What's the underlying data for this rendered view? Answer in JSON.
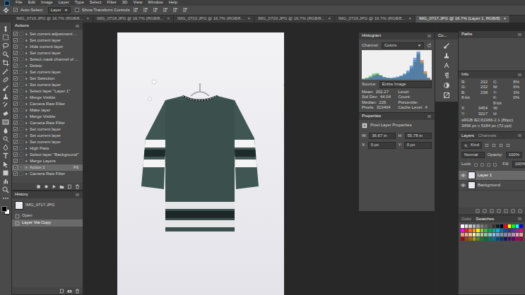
{
  "menu": [
    "File",
    "Edit",
    "Image",
    "Layer",
    "Type",
    "Select",
    "Filter",
    "3D",
    "View",
    "Window",
    "Help"
  ],
  "options_bar": {
    "auto_select_label": "Auto-Select:",
    "auto_select": true,
    "target": "Layer",
    "transform_label": "Show Transform Controls",
    "transform": false
  },
  "tab_close": "×",
  "document_tabs": [
    {
      "label": "IMG_0716.JPG @ 16.7% (RGB/8...",
      "selected": false
    },
    {
      "label": "IMG_0718.JPG @ 16.7% (RGB/8...",
      "selected": false
    },
    {
      "label": "IMG_0722.JPG @ 16.7% (RGB/8...",
      "selected": false
    },
    {
      "label": "IMG_0720.JPG @ 16.7% (RGB/8...",
      "selected": false
    },
    {
      "label": "IMG_0719.JPG @ 16.7% (RGB/8...",
      "selected": false
    },
    {
      "label": "IMG_0717.JPG @ 16.7% (Layer 1, RGB/8)",
      "selected": true
    }
  ],
  "actions": {
    "title": "Actions",
    "items": [
      {
        "label": "Set current adjustment ...",
        "checked": true,
        "selected": false
      },
      {
        "label": "Set current layer",
        "checked": true,
        "selected": false
      },
      {
        "label": "Hide current layer",
        "checked": true,
        "selected": false
      },
      {
        "label": "Set current layer",
        "checked": true,
        "selected": false
      },
      {
        "label": "Select mask channel of ...",
        "checked": true,
        "selected": false
      },
      {
        "label": "Delete",
        "checked": true,
        "selected": false
      },
      {
        "label": "Set current layer",
        "checked": true,
        "selected": false
      },
      {
        "label": "Set Selection",
        "checked": true,
        "selected": false
      },
      {
        "label": "Set current layer",
        "checked": true,
        "selected": false
      },
      {
        "label": "Select layer \"Layer 1\"",
        "checked": true,
        "selected": false
      },
      {
        "label": "Merge Visible",
        "checked": true,
        "selected": false
      },
      {
        "label": "Camera Raw Filter",
        "checked": true,
        "selected": false
      },
      {
        "label": "Make layer",
        "checked": true,
        "selected": false
      },
      {
        "label": "Merge Visible",
        "checked": true,
        "selected": false
      },
      {
        "label": "Camera Raw Filter",
        "checked": true,
        "selected": false
      },
      {
        "label": "Set current layer",
        "checked": true,
        "selected": false
      },
      {
        "label": "Set current layer",
        "checked": true,
        "selected": false
      },
      {
        "label": "Set current layer",
        "checked": true,
        "selected": false
      },
      {
        "label": "High Pass",
        "checked": true,
        "selected": false
      },
      {
        "label": "Select layer \"Background\"",
        "checked": true,
        "selected": false
      },
      {
        "label": "Merge Layers",
        "checked": true,
        "selected": false
      },
      {
        "label": "Action 1",
        "key": "F6",
        "checked": true,
        "selected": true
      },
      {
        "label": "Camera Raw Filter",
        "checked": true,
        "selected": false
      }
    ]
  },
  "history": {
    "title": "History",
    "snapshot": "IMG_0717.JPG",
    "items": [
      {
        "label": "Open",
        "selected": false
      },
      {
        "label": "Layer Via Copy",
        "selected": true
      }
    ]
  },
  "histogram": {
    "title": "Histogram",
    "channel_label": "Channel:",
    "channel": "Colors",
    "source_label": "Source:",
    "source": "Entire Image",
    "series": [
      {
        "name": "red",
        "color": "#e8322c",
        "values": [
          3,
          5,
          9,
          16,
          20,
          15,
          9,
          6,
          5,
          6,
          8,
          11,
          16,
          24,
          38,
          62,
          88,
          70,
          30,
          8
        ]
      },
      {
        "name": "green",
        "color": "#2fbf3a",
        "values": [
          4,
          8,
          14,
          22,
          24,
          17,
          10,
          7,
          6,
          7,
          9,
          13,
          19,
          28,
          44,
          70,
          95,
          64,
          24,
          6
        ]
      },
      {
        "name": "blue",
        "color": "#2f5fe0",
        "values": [
          2,
          4,
          8,
          14,
          18,
          14,
          9,
          7,
          6,
          8,
          11,
          15,
          22,
          33,
          50,
          78,
          100,
          58,
          20,
          5
        ]
      }
    ],
    "stats_left": [
      {
        "label": "Mean:",
        "value": "202.27"
      },
      {
        "label": "Std Dev:",
        "value": "44.04"
      },
      {
        "label": "Median:",
        "value": "226"
      },
      {
        "label": "Pixels:",
        "value": "313404"
      }
    ],
    "stats_right": [
      {
        "label": "Level:"
      },
      {
        "label": "Count:"
      },
      {
        "label": "Percentile:"
      },
      {
        "label": "Cache Level:",
        "value": "4"
      }
    ]
  },
  "properties": {
    "title": "Properties",
    "subtitle": "Pixel Layer Properties",
    "fields": [
      {
        "label": "W:",
        "value": "36.67 in"
      },
      {
        "label": "H:",
        "value": "55.78 in"
      },
      {
        "label": "X:",
        "value": "0 px"
      },
      {
        "label": "Y:",
        "value": "0 px"
      }
    ]
  },
  "tools_panel": {
    "title": "Co..."
  },
  "paths": {
    "title": "Paths"
  },
  "info": {
    "title": "Info",
    "left": [
      {
        "label": "R:",
        "value": "232"
      },
      {
        "label": "G:",
        "value": "232"
      },
      {
        "label": "B:",
        "value": "238"
      }
    ],
    "right": [
      {
        "label": "C:",
        "value": "8%"
      },
      {
        "label": "M:",
        "value": "6%"
      },
      {
        "label": "Y:",
        "value": "3%"
      },
      {
        "label": "K:",
        "value": "0%"
      }
    ],
    "bits_left": "8-bit",
    "bits_right": "8-bit",
    "xy": [
      {
        "label": "X:",
        "value": "3454"
      },
      {
        "label": "Y:",
        "value": "3217"
      }
    ],
    "wh": [
      {
        "label": "W:"
      },
      {
        "label": "H:"
      }
    ],
    "profile": "sRGB IEC61966-2.1 (8bpc)",
    "size": "3456 px x 5184 px (72 ppi)"
  },
  "layers": {
    "tabs": [
      {
        "label": "Layers",
        "selected": true
      },
      {
        "label": "Channels",
        "selected": false
      }
    ],
    "filter": "Kind",
    "blend": "Normal",
    "opacity_label": "Opacity:",
    "opacity": "100%",
    "lock_label": "Lock:",
    "fill_label": "Fill:",
    "fill": "100%",
    "items": [
      {
        "name": "Layer 1",
        "visible": true,
        "selected": true
      },
      {
        "name": "Background",
        "visible": true,
        "selected": false
      }
    ]
  },
  "swatches": {
    "tabs": [
      {
        "label": "Color",
        "selected": false
      },
      {
        "label": "Swatches",
        "selected": true
      }
    ],
    "colors": [
      "#ffffff",
      "#e6e6e6",
      "#cccccc",
      "#b3b3b3",
      "#999999",
      "#808080",
      "#666666",
      "#4d4d4d",
      "#333333",
      "#1a1a1a",
      "#000000",
      "#ff0000",
      "#ffff00",
      "#00ff00",
      "#00ffff",
      "#0000ff",
      "#ff00ff",
      "#ed1c24",
      "#f26522",
      "#f7941d",
      "#fff200",
      "#8dc63f",
      "#39b54a",
      "#00a651",
      "#00a99d",
      "#00aeef",
      "#0072bc",
      "#0054a6",
      "#2e3192",
      "#662d91",
      "#92278f",
      "#ec008c",
      "#f69679",
      "#f9ad81",
      "#fdc68a",
      "#fff79a",
      "#c4df9b",
      "#a3d39c",
      "#82ca9d",
      "#7bcdc8",
      "#6dcff6",
      "#7da7d9",
      "#8393ca",
      "#8781bd",
      "#a186be",
      "#bd8cbf",
      "#f49ac1",
      "#f5989d",
      "#9e0b0f",
      "#a0410d",
      "#a3620a",
      "#aba000",
      "#598527",
      "#197b30",
      "#007236",
      "#00746b",
      "#0076a3",
      "#004a80",
      "#003471",
      "#1b1464",
      "#440e62",
      "#630460",
      "#9e005d",
      "#9e0039"
    ]
  }
}
